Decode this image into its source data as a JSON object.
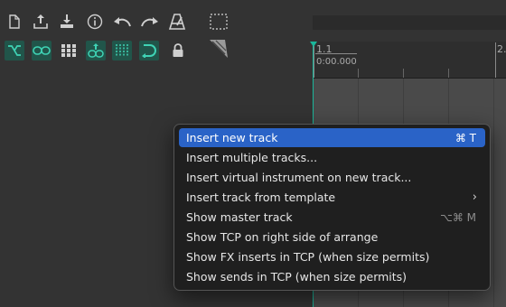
{
  "toolbar": {
    "row1": [
      "new-file-icon",
      "export-icon",
      "import-icon",
      "info-icon",
      "undo-icon",
      "redo-icon",
      "metronome-icon",
      "selection-box-icon"
    ],
    "row2": [
      "ripple-edit-icon",
      "link-icon",
      "grid-snap-icon",
      "link-items-icon",
      "grid-lines-icon",
      "loop-icon",
      "lock-icon",
      "envelope-tool-icon"
    ]
  },
  "ruler": {
    "marker1_bar": "1.1",
    "marker1_time": "0:00.000",
    "marker2_bar": "2."
  },
  "context_menu": {
    "items": [
      {
        "label": "Insert new track",
        "shortcut": "⌘ T",
        "highlighted": true
      },
      {
        "label": "Insert multiple tracks..."
      },
      {
        "label": "Insert virtual instrument on new track..."
      },
      {
        "label": "Insert track from template",
        "submenu": true
      },
      {
        "label": "Show master track",
        "shortcut": "⌥⌘ M"
      },
      {
        "label": "Show TCP on right side of arrange"
      },
      {
        "label": "Show FX inserts in TCP (when size permits)"
      },
      {
        "label": "Show sends in TCP (when size permits)"
      }
    ]
  },
  "colors": {
    "background": "#333333",
    "accent_teal": "#1ab69a",
    "active_button": "#21554a",
    "menu_bg": "#1f1f1f",
    "menu_highlight": "#2a63c7"
  }
}
